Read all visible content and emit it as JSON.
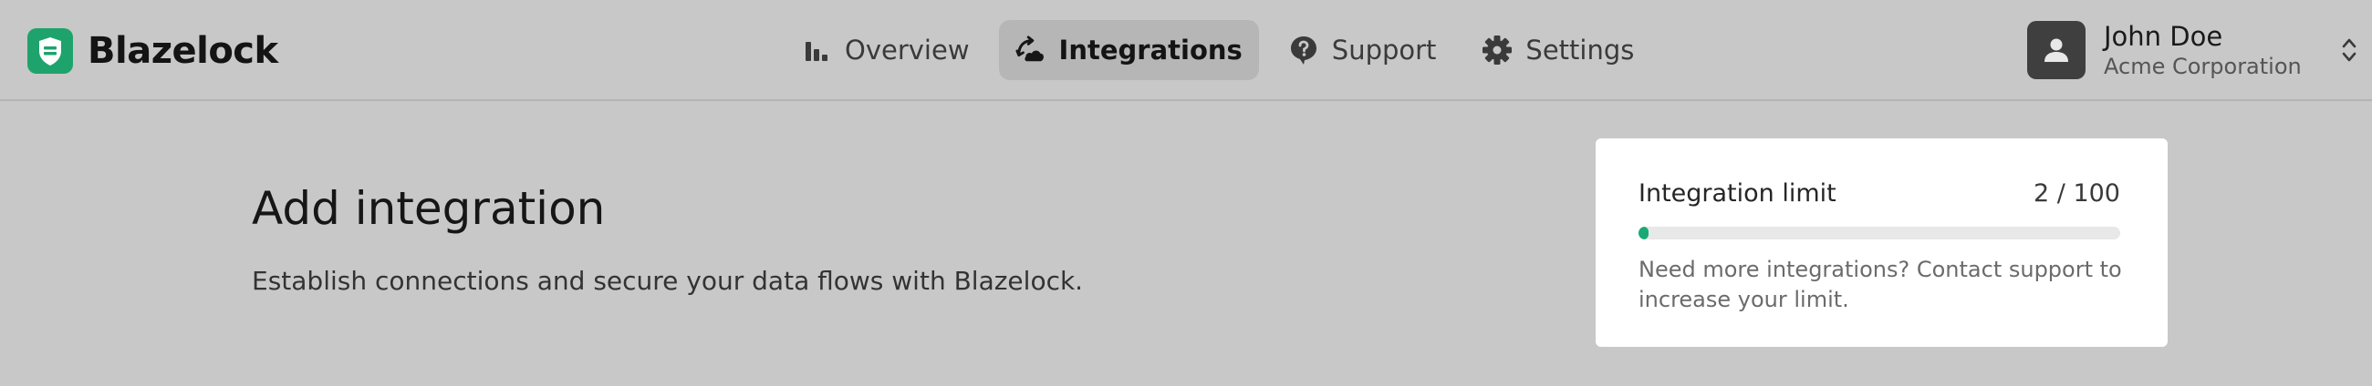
{
  "brand": {
    "name": "Blazelock",
    "logo_icon": "shield-icon",
    "accent": "#1fa36d"
  },
  "nav": {
    "items": [
      {
        "label": "Overview",
        "icon": "bar-chart-icon",
        "active": false
      },
      {
        "label": "Integrations",
        "icon": "integrations-icon",
        "active": true
      },
      {
        "label": "Support",
        "icon": "help-bubble-icon",
        "active": false
      },
      {
        "label": "Settings",
        "icon": "gear-icon",
        "active": false
      }
    ]
  },
  "user": {
    "name": "John Doe",
    "organization": "Acme Corporation",
    "avatar_icon": "user-icon",
    "menu_icon": "chevron-up-down-icon"
  },
  "page": {
    "title": "Add integration",
    "description": "Establish connections and secure your data flows with Blazelock."
  },
  "limit_card": {
    "label": "Integration limit",
    "count_text": "2 / 100",
    "used": 2,
    "max": 100,
    "progress_color": "#19a974",
    "note": "Need more integrations? Contact support to increase your limit."
  }
}
